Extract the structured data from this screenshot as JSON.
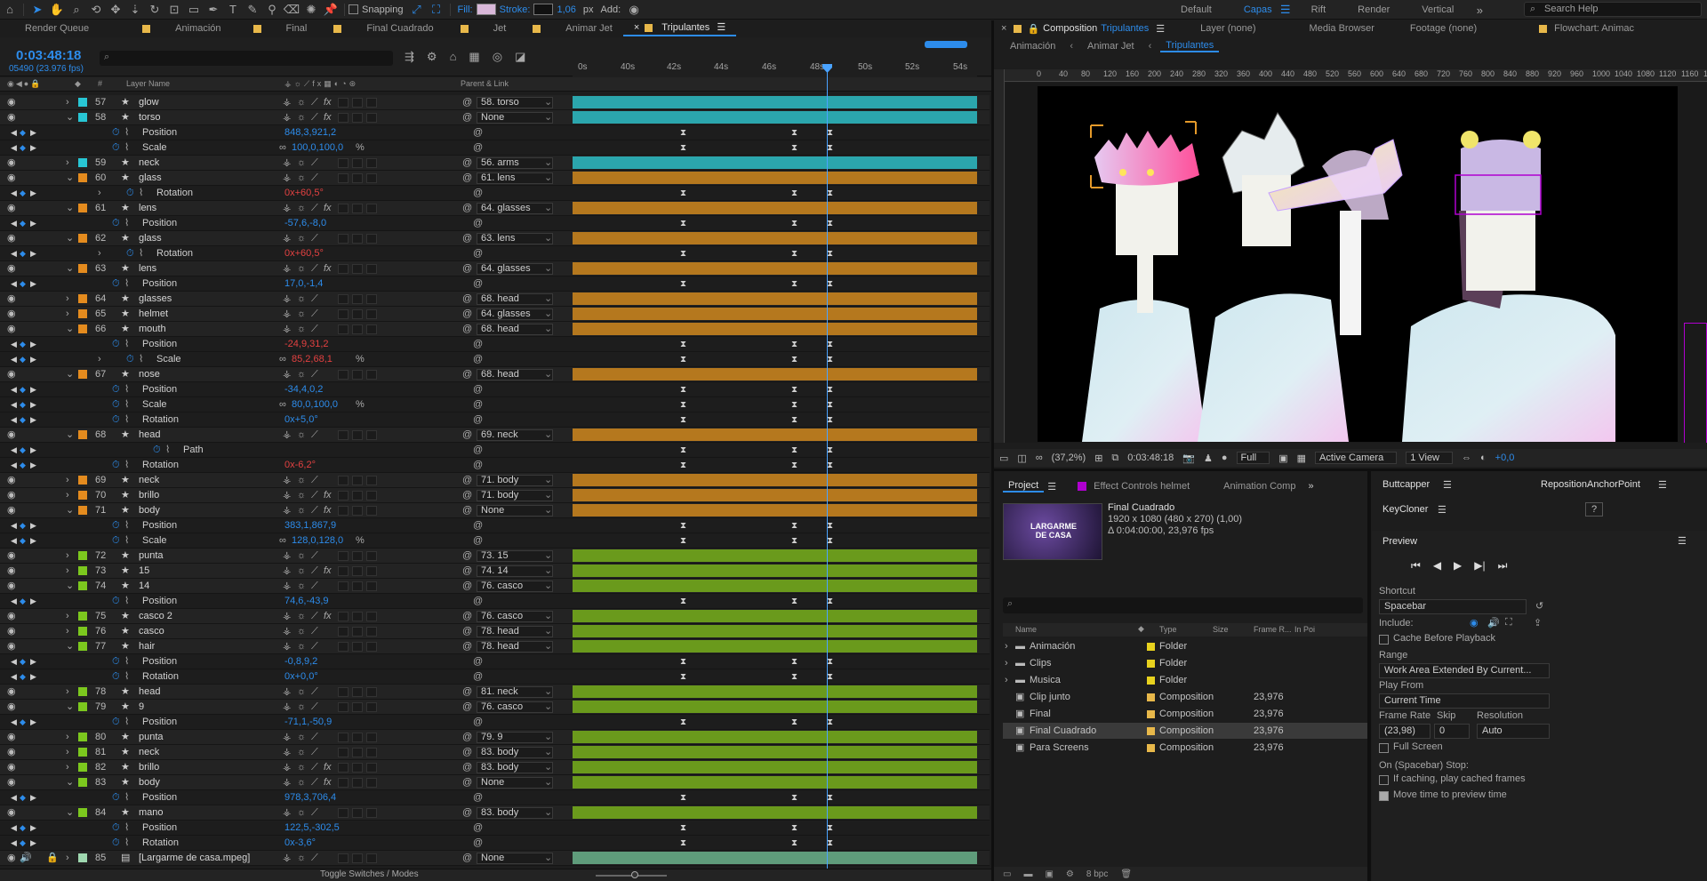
{
  "toolbar": {
    "snapping": "Snapping",
    "fill": "Fill:",
    "stroke": "Stroke:",
    "stroke_width": "1,06",
    "stroke_unit": "px",
    "add": "Add:",
    "workspaces": [
      "Default",
      "Capas",
      "Rift",
      "Render",
      "Vertical"
    ],
    "active_workspace": "Capas",
    "help_placeholder": "Search Help"
  },
  "timeline": {
    "tabs": [
      "Render Queue",
      "Animación",
      "Final",
      "Final Cuadrado",
      "Jet",
      "Animar Jet",
      "Tripulantes"
    ],
    "active_tab": "Tripulantes",
    "timecode": "0:03:48:18",
    "frame_fps": "05490 (23.976 fps)",
    "col_layer_name": "Layer Name",
    "col_parent": "Parent & Link",
    "ruler": [
      "0s",
      "40s",
      "42s",
      "44s",
      "46s",
      "48s",
      "50s",
      "52s",
      "54s"
    ],
    "footer": "Toggle Switches / Modes",
    "rows": [
      {
        "t": "layer",
        "num": "57",
        "name": "glow",
        "color": "#28c6d4",
        "fx": true,
        "parent": "58. torso",
        "bar": "cyan"
      },
      {
        "t": "layer",
        "num": "58",
        "name": "torso",
        "color": "#28c6d4",
        "fx": true,
        "parent": "None",
        "bar": "cyan",
        "open": true
      },
      {
        "t": "prop",
        "name": "Position",
        "value": "848,3,921,2"
      },
      {
        "t": "prop",
        "name": "Scale",
        "value": "100,0,100,0",
        "unit": "%"
      },
      {
        "t": "layer",
        "num": "59",
        "name": "neck",
        "color": "#28c6d4",
        "fx": false,
        "parent": "56. arms",
        "bar": "cyan"
      },
      {
        "t": "layer",
        "num": "60",
        "name": "glass",
        "color": "#e48b1e",
        "fx": false,
        "parent": "61. lens",
        "bar": "orange",
        "open": true
      },
      {
        "t": "prop",
        "name": "Rotation",
        "value": "0x+60,5°",
        "red": true,
        "indent": true
      },
      {
        "t": "layer",
        "num": "61",
        "name": "lens",
        "color": "#e48b1e",
        "fx": true,
        "parent": "64. glasses",
        "bar": "orange",
        "open": true
      },
      {
        "t": "prop",
        "name": "Position",
        "value": "-57,6,-8,0"
      },
      {
        "t": "layer",
        "num": "62",
        "name": "glass",
        "color": "#e48b1e",
        "fx": false,
        "parent": "63. lens",
        "bar": "orange",
        "open": true
      },
      {
        "t": "prop",
        "name": "Rotation",
        "value": "0x+60,5°",
        "red": true,
        "indent": true
      },
      {
        "t": "layer",
        "num": "63",
        "name": "lens",
        "color": "#e48b1e",
        "fx": true,
        "parent": "64. glasses",
        "bar": "orange",
        "open": true
      },
      {
        "t": "prop",
        "name": "Position",
        "value": "17,0,-1,4"
      },
      {
        "t": "layer",
        "num": "64",
        "name": "glasses",
        "color": "#e48b1e",
        "fx": false,
        "parent": "68. head",
        "bar": "orange"
      },
      {
        "t": "layer",
        "num": "65",
        "name": "helmet",
        "color": "#e48b1e",
        "fx": false,
        "parent": "64. glasses",
        "bar": "orange"
      },
      {
        "t": "layer",
        "num": "66",
        "name": "mouth",
        "color": "#e48b1e",
        "fx": false,
        "parent": "68. head",
        "bar": "orange",
        "open": true
      },
      {
        "t": "prop",
        "name": "Position",
        "value": "-24,9,31,2",
        "red": true
      },
      {
        "t": "prop",
        "name": "Scale",
        "value": "85,2,68,1",
        "unit": "%",
        "red": true,
        "indent": true
      },
      {
        "t": "layer",
        "num": "67",
        "name": "nose",
        "color": "#e48b1e",
        "fx": false,
        "parent": "68. head",
        "bar": "orange",
        "open": true
      },
      {
        "t": "prop",
        "name": "Position",
        "value": "-34,4,0,2"
      },
      {
        "t": "prop",
        "name": "Scale",
        "value": "80,0,100,0",
        "unit": "%"
      },
      {
        "t": "prop",
        "name": "Rotation",
        "value": "0x+5,0°"
      },
      {
        "t": "layer",
        "num": "68",
        "name": "head",
        "color": "#e48b1e",
        "fx": false,
        "parent": "69. neck",
        "bar": "orange",
        "open": true
      },
      {
        "t": "prop",
        "name": "Path",
        "value": "",
        "indent2": true
      },
      {
        "t": "prop",
        "name": "Rotation",
        "value": "0x-6,2°",
        "red": true
      },
      {
        "t": "layer",
        "num": "69",
        "name": "neck",
        "color": "#e48b1e",
        "fx": false,
        "parent": "71. body",
        "bar": "orange"
      },
      {
        "t": "layer",
        "num": "70",
        "name": "brillo",
        "color": "#e48b1e",
        "fx": true,
        "parent": "71. body",
        "bar": "orange"
      },
      {
        "t": "layer",
        "num": "71",
        "name": "body",
        "color": "#e48b1e",
        "fx": true,
        "parent": "None",
        "bar": "orange",
        "open": true
      },
      {
        "t": "prop",
        "name": "Position",
        "value": "383,1,867,9"
      },
      {
        "t": "prop",
        "name": "Scale",
        "value": "128,0,128,0",
        "unit": "%"
      },
      {
        "t": "layer",
        "num": "72",
        "name": "punta",
        "color": "#7cc81e",
        "fx": false,
        "parent": "73. 15",
        "bar": "green"
      },
      {
        "t": "layer",
        "num": "73",
        "name": "15",
        "color": "#7cc81e",
        "fx": true,
        "parent": "74. 14",
        "bar": "green"
      },
      {
        "t": "layer",
        "num": "74",
        "name": "14",
        "color": "#7cc81e",
        "fx": false,
        "parent": "76. casco",
        "bar": "green",
        "open": true
      },
      {
        "t": "prop",
        "name": "Position",
        "value": "74,6,-43,9"
      },
      {
        "t": "layer",
        "num": "75",
        "name": "casco 2",
        "color": "#7cc81e",
        "fx": true,
        "parent": "76. casco",
        "bar": "green"
      },
      {
        "t": "layer",
        "num": "76",
        "name": "casco",
        "color": "#7cc81e",
        "fx": false,
        "parent": "78. head",
        "bar": "green"
      },
      {
        "t": "layer",
        "num": "77",
        "name": "hair",
        "color": "#7cc81e",
        "fx": false,
        "parent": "78. head",
        "bar": "green",
        "open": true
      },
      {
        "t": "prop",
        "name": "Position",
        "value": "-0,8,9,2"
      },
      {
        "t": "prop",
        "name": "Rotation",
        "value": "0x+0,0°"
      },
      {
        "t": "layer",
        "num": "78",
        "name": "head",
        "color": "#7cc81e",
        "fx": false,
        "parent": "81. neck",
        "bar": "green"
      },
      {
        "t": "layer",
        "num": "79",
        "name": "9",
        "color": "#7cc81e",
        "fx": false,
        "parent": "76. casco",
        "bar": "green",
        "open": true
      },
      {
        "t": "prop",
        "name": "Position",
        "value": "-71,1,-50,9"
      },
      {
        "t": "layer",
        "num": "80",
        "name": "punta",
        "color": "#7cc81e",
        "fx": false,
        "parent": "79. 9",
        "bar": "green"
      },
      {
        "t": "layer",
        "num": "81",
        "name": "neck",
        "color": "#7cc81e",
        "fx": false,
        "parent": "83. body",
        "bar": "green"
      },
      {
        "t": "layer",
        "num": "82",
        "name": "brillo",
        "color": "#7cc81e",
        "fx": true,
        "parent": "83. body",
        "bar": "green"
      },
      {
        "t": "layer",
        "num": "83",
        "name": "body",
        "color": "#7cc81e",
        "fx": true,
        "parent": "None",
        "bar": "green",
        "open": true
      },
      {
        "t": "prop",
        "name": "Position",
        "value": "978,3,706,4"
      },
      {
        "t": "layer",
        "num": "84",
        "name": "mano",
        "color": "#7cc81e",
        "fx": false,
        "parent": "83. body",
        "bar": "green",
        "open": true
      },
      {
        "t": "prop",
        "name": "Position",
        "value": "122,5,-302,5"
      },
      {
        "t": "prop",
        "name": "Rotation",
        "value": "0x-3,6°"
      },
      {
        "t": "audio",
        "num": "85",
        "name": "[Largarme de casa.mpeg]",
        "color": "#9fd8b0",
        "parent": "None",
        "bar": "teal"
      }
    ]
  },
  "composition": {
    "tabs_label": "Composition",
    "comp_name": "Tripulantes",
    "layer_tab": "Layer (none)",
    "media_browser": "Media Browser",
    "footage_tab": "Footage (none)",
    "flowchart_tab": "Flowchart: Animac",
    "crumbs": [
      "Animación",
      "Animar Jet",
      "Tripulantes"
    ],
    "active_crumb": "Tripulantes",
    "ruler": [
      "0",
      "40",
      "80",
      "120",
      "160",
      "200",
      "240",
      "280",
      "320",
      "360",
      "400",
      "440",
      "480",
      "520",
      "560",
      "600",
      "640",
      "680",
      "720",
      "760",
      "800",
      "840",
      "880",
      "920",
      "960",
      "1000",
      "1040",
      "1080",
      "1120",
      "1160",
      "1200"
    ],
    "zoom": "(37,2%)",
    "timecode": "0:03:48:18",
    "resolution": "Full",
    "camera": "Active Camera",
    "views": "1 View",
    "exposure": "+0,0"
  },
  "project": {
    "tabs": [
      "Project",
      "Effect Controls helmet",
      "Animation Comp"
    ],
    "selected": "Final Cuadrado",
    "info": [
      "1920 x 1080  (480 x 270) (1,00)",
      "Δ 0:04:00:00, 23,976 fps"
    ],
    "thumb_text": "LARGARME DE CASA",
    "cols": [
      "Name",
      "Type",
      "Size",
      "Frame R...",
      "In Poi"
    ],
    "items": [
      {
        "name": "Animación",
        "type": "Folder",
        "fps": "",
        "kind": "folder",
        "color": "#e8d21e"
      },
      {
        "name": "Clips",
        "type": "Folder",
        "fps": "",
        "kind": "folder",
        "color": "#e8d21e"
      },
      {
        "name": "Musica",
        "type": "Folder",
        "fps": "",
        "kind": "folder",
        "color": "#e8d21e"
      },
      {
        "name": "Clip junto",
        "type": "Composition",
        "fps": "23,976",
        "kind": "comp",
        "color": "#e8b84a"
      },
      {
        "name": "Final",
        "type": "Composition",
        "fps": "23,976",
        "kind": "comp",
        "color": "#e8b84a"
      },
      {
        "name": "Final Cuadrado",
        "type": "Composition",
        "fps": "23,976",
        "kind": "comp",
        "color": "#e8b84a"
      },
      {
        "name": "Para Screens",
        "type": "Composition",
        "fps": "23,976",
        "kind": "comp",
        "color": "#e8b84a"
      }
    ],
    "bpc": "8 bpc"
  },
  "right": {
    "buttcapper": "Buttcapper",
    "reposition": "RepositionAnchorPoint",
    "keycloner": "KeyCloner",
    "help_btn": "?"
  },
  "preview": {
    "title": "Preview",
    "shortcut_label": "Shortcut",
    "shortcut": "Spacebar",
    "include": "Include:",
    "cache": "Cache Before Playback",
    "range_label": "Range",
    "range": "Work Area Extended By Current...",
    "playfrom_label": "Play From",
    "playfrom": "Current Time",
    "framerate_label": "Frame Rate",
    "skip_label": "Skip",
    "res_label": "Resolution",
    "framerate": "(23,98)",
    "skip": "0",
    "res": "Auto",
    "fullscreen": "Full Screen",
    "stop_label": "On (Spacebar) Stop:",
    "cached": "If caching, play cached frames",
    "move_time": "Move time to preview time"
  },
  "colors": {
    "accent": "#2d8ceb",
    "cyan": "#2ba6ad",
    "orange": "#b5781e",
    "green": "#6a9a1c"
  }
}
